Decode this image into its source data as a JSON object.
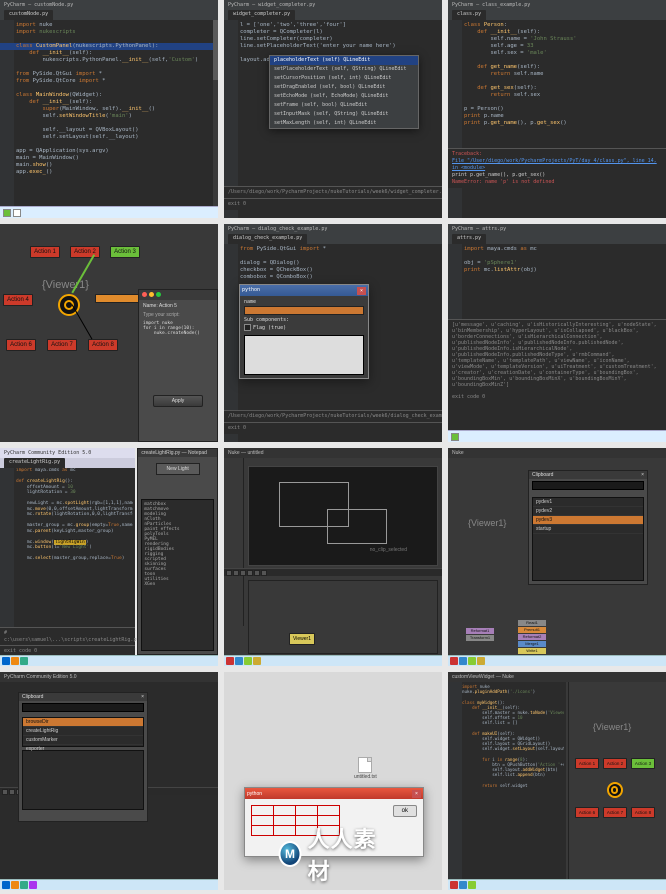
{
  "thumbs": {
    "t1": {
      "title": "PyCharm — customNode.py",
      "tabs": [
        "customNode.py"
      ],
      "selected_pkg": "nukescripts",
      "code_lines": [
        {
          "t": "import ",
          "c": "kw"
        },
        {
          "t": "nuke\n"
        },
        {
          "t": "import ",
          "c": "kw"
        },
        {
          "t": "nukescripts\n\n"
        },
        {
          "t": "class ",
          "c": "kw"
        },
        {
          "t": "CustomPanel",
          "c": "fn"
        },
        {
          "t": "(nukescripts.PythonPanel):\n"
        },
        {
          "t": "    def ",
          "c": "kw"
        },
        {
          "t": "__init__",
          "c": "fn"
        },
        {
          "t": "(self):\n"
        },
        {
          "t": "        nukescripts.PythonPanel.",
          "c": ""
        },
        {
          "t": "__init__",
          "c": "fn"
        },
        {
          "t": "(self,",
          "c": ""
        },
        {
          "t": "'Custom'",
          "c": "str"
        },
        {
          "t": ")\n\n"
        },
        {
          "t": "from ",
          "c": "kw"
        },
        {
          "t": "PySide.QtGui ",
          "c": ""
        },
        {
          "t": "import ",
          "c": "kw"
        },
        {
          "t": "*\n"
        },
        {
          "t": "from ",
          "c": "kw"
        },
        {
          "t": "PySide.QtCore ",
          "c": ""
        },
        {
          "t": "import ",
          "c": "kw"
        },
        {
          "t": "*\n\n"
        },
        {
          "t": "class ",
          "c": "kw"
        },
        {
          "t": "MainWindow",
          "c": "fn"
        },
        {
          "t": "(QWidget):\n"
        },
        {
          "t": "    def ",
          "c": "kw"
        },
        {
          "t": "__init__",
          "c": "fn"
        },
        {
          "t": "(self):\n"
        },
        {
          "t": "        super",
          "c": "kw"
        },
        {
          "t": "(MainWindow, self).",
          "c": ""
        },
        {
          "t": "__init__",
          "c": "fn"
        },
        {
          "t": "()\n"
        },
        {
          "t": "        self.",
          "c": ""
        },
        {
          "t": "setWindowTitle",
          "c": "fn"
        },
        {
          "t": "(",
          "c": ""
        },
        {
          "t": "'main'",
          "c": "str"
        },
        {
          "t": ")\n\n"
        },
        {
          "t": "        self.",
          "c": ""
        },
        {
          "t": "__layout",
          "c": ""
        },
        {
          "t": " = QVBoxLayout()\n"
        },
        {
          "t": "        self.setLayout(self.",
          "c": ""
        },
        {
          "t": "__layout",
          "c": ""
        },
        {
          "t": ")\n\n"
        },
        {
          "t": "app = QApplication(sys.argv)\n"
        },
        {
          "t": "main = MainWindow()\n"
        },
        {
          "t": "main.",
          "c": ""
        },
        {
          "t": "show",
          "c": "fn"
        },
        {
          "t": "()\n"
        },
        {
          "t": "app.",
          "c": ""
        },
        {
          "t": "exec_",
          "c": "fn"
        },
        {
          "t": "()\n"
        }
      ]
    },
    "t2": {
      "title": "PyCharm — widget_completer.py",
      "path": "/Users/diego/work/PycharmProjects/nukeTutorials/week6/widget_completer.py",
      "exit": "exit 0",
      "code_pre": "l = ['one','two','three','four']\ncompleter = QCompleter(l)\nline.setCompleter(completer)\nline.setPlaceholderText('enter your name here')\n\nlayout.addWidget(line)",
      "popup_items": [
        "placeholderText (self) QLineEdit",
        "setPlaceholderText (self, QString) QLineEdit",
        "setCursorPosition (self, int) QLineEdit",
        "setDragEnabled (self, bool) QLineEdit",
        "setEchoMode (self, EchoMode) QLineEdit",
        "setFrame (self, bool) QLineEdit",
        "setInputMask (self, QString) QLineEdit",
        "setMaxLength (self, int) QLineEdit"
      ]
    },
    "t3": {
      "title": "PyCharm — class_example.py",
      "code_pre": "class Person:\n    def __init__(self):\n        self.name = 'John Strauss'\n        self.age = 33\n        self.sex = 'male'\n\n    def get_name(self):\n        return self.name\n\n    def get_sex(self):\n        return self.sex\n\np = Person()\nprint p.name\nprint p.get_name(), p.get_sex()\n",
      "err1": "File \"/User/diego/work/PycharmProjects/PyT/day_4/class.py\", line 14, in <module>",
      "err2": "NameError: name 'p' is not defined",
      "err3": "print p.get_name(), p.get_sex()"
    },
    "t4": {
      "viewer": "{Viewer1}",
      "actions": [
        "Action 1",
        "Action 2",
        "Action 3",
        "Action 4",
        "Action 5",
        "Action 6",
        "Action 7",
        "Action 8"
      ],
      "panel": {
        "name_label": "Name:",
        "name_value": "Action 5",
        "hint": "Type your script:",
        "script": "import nuke\nfor i in range(10):\n    nuke.createNode()",
        "apply": "Apply"
      }
    },
    "t5": {
      "title": "PyCharm — dialog_check_example.py",
      "dlg_title": "python",
      "labels": {
        "sub": "Sub components:",
        "flag": "Flag (true)"
      },
      "path": "/Users/diego/work/PycharmProjects/nukeTutorials/week6/dialog_check_example.py",
      "exit": "exit 0"
    },
    "t6": {
      "title": "PyCharm — attrs.py",
      "pre": "import maya.cmds as mc\n\nobj = 'pSphere1'\nprint mc.listAttr(obj)\n",
      "attrs": "[u'message', u'caching', u'isHistoricallyInteresting', u'nodeState', u'binMembership', u'hyperLayout', u'isCollapsed', u'blackBox', u'borderConnections', u'isHierarchicalConnection', u'publishedNodeInfo', u'publishedNodeInfo.publishedNode', u'publishedNodeInfo.isHierarchicalNode', u'publishedNodeInfo.publishedNodeType', u'rmbCommand', u'templateName', u'templatePath', u'viewName', u'iconName', u'viewMode', u'templateVersion', u'uiTreatment', u'customTreatment', u'creator', u'creationDate', u'containerType', u'boundingBox', u'boundingBoxMin', u'boundingBoxMinX', u'boundingBoxMinY', u'boundingBoxMinZ']",
      "exit": "exit code 0"
    },
    "t7": {
      "title_left": "PyCharm Community Edition 5.0",
      "file_left": "createLightRig.py",
      "title_right": "createLightRig.py — Notepad",
      "highlight": "lightRigWin",
      "code_left": "import maya.cmds as mc\n\ndef createLightRig():\n    offsetAmount = 10\n    lightRotation = 30\n\n    newLight = mc.spotLight(rgb=[1,1,1],name='KeyLight')\n    lightTransform = mc.listRelatives(newLight,p=True)[0]\n    mc.move(0,0,offsetAmount,lightTransform)\n    mc.rotate(lightRotation,0,0,lightTransform)\n\n    master_group = mc.group(empty=True,name='LightRig')\n    mc.parent(keyLight,master_group)\n\n    offset_group = mc.group(empty=True)\n    mc.move(0,offsetAmount,0,offset_group)\n    mc.parent(offset_group,master_group)\n\n    mc.select(master_group,replace=True)\n",
      "console": "# c:\\users\\samuel\\...\\scripts\\createLightRig.py",
      "exit": "exit code 0",
      "btn": "New Light"
    },
    "t8": {
      "title": "Nuke — untitled",
      "viewport_label": "no_clip_selected",
      "node": "Viewer1"
    },
    "t9": {
      "viewer": "{Viewer1}",
      "clipboard_hdr": "Clipboard",
      "clip_items": [
        "pydev1",
        "pydev2",
        "pydev3",
        "startup"
      ],
      "stack1": [
        "Reformat1",
        "Transform1"
      ],
      "stack2": [
        "Read1",
        "Premult1",
        "Reformat2",
        "Merge1",
        "Write1"
      ]
    },
    "t10": {
      "title": "PyCharm Community Edition 5.0",
      "clipboard_hdr": "Clipboard",
      "rows": [
        "browseDir",
        "createLightRig",
        "customMarker",
        "exporter"
      ],
      "list_items": [
        "matchbox",
        "matchmove",
        "modeling",
        "nCloth",
        "nParticles",
        "paint effects",
        "polyTools",
        "PyMEL",
        "rendering",
        "rigidBodies",
        "rigging",
        "scripted",
        "skinning",
        "surfaces",
        "toon",
        "utilities",
        "XGen"
      ]
    },
    "t11": {
      "dlg_title": "python",
      "ok": "ok",
      "icon": "untitled.txt"
    },
    "t12": {
      "title": "customViewWidget — Nuke",
      "viewer": "{Viewer1}",
      "actions_row1": [
        "Action 1",
        "Action 2",
        "Action 3"
      ],
      "actions_row2": [
        "Action 6",
        "Action 7",
        "Action 8"
      ],
      "code": "import nuke\nnuke.pluginAddPath('./icons')\n\nclass myWidget():\n    def __init__(self):\n        self.master = nuke.toNode('Viewer1')\n        self.offset = 10\n        self.list = []\n\n    def makeUI(self):\n        self.widget = QWidget()\n        self.layout = QGridLayout()\n        self.widget.setLayout(self.layout)\n\n        for i in range(8):\n            btn = QPushButton('Action ' + str(i+1))\n            self.layout.addWidget(btn)\n            self.list.append(btn)\n\n        return self.widget\n"
    }
  },
  "watermark": {
    "badge": "M",
    "text": "人人素材"
  }
}
